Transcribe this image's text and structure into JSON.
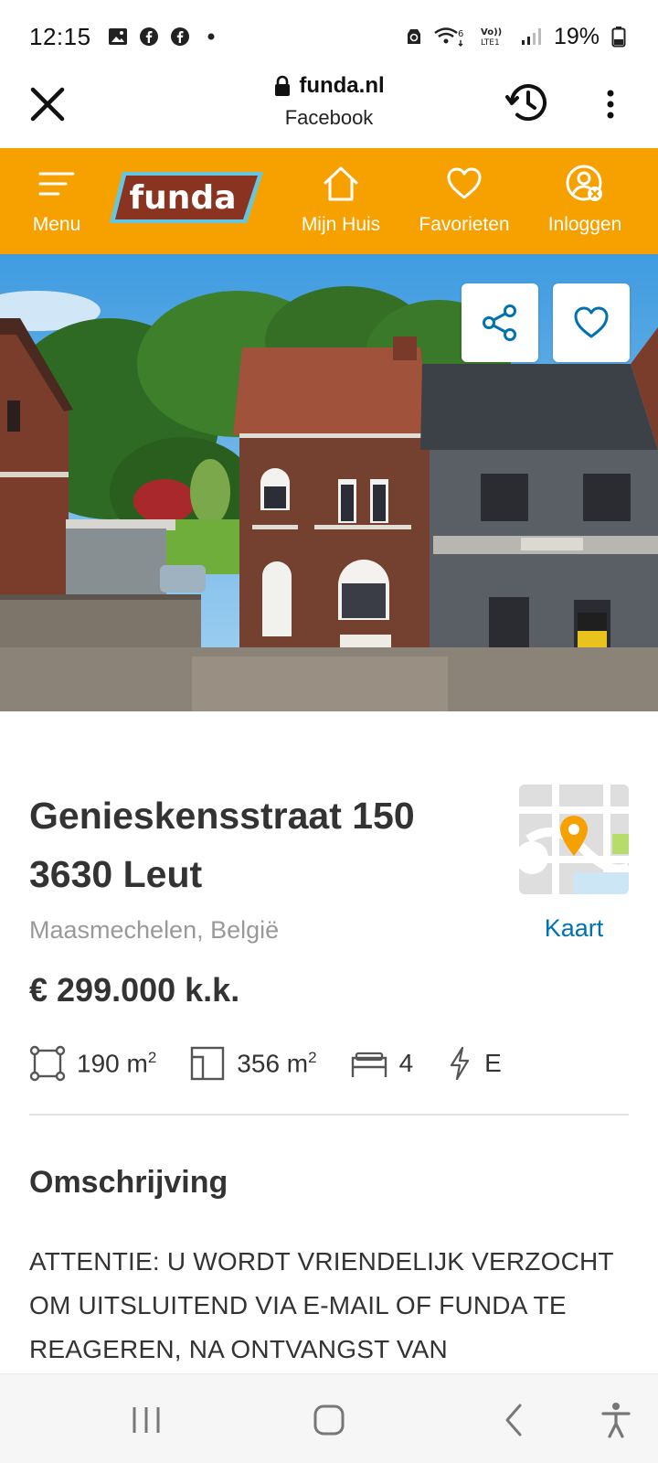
{
  "status_bar": {
    "time": "12:15",
    "left_icons": [
      "image-icon",
      "facebook-icon",
      "facebook-icon",
      "dot-icon"
    ],
    "right_icons": [
      "recycle-icon",
      "wifi6-icon",
      "volte-icon",
      "signal-icon"
    ],
    "battery": "19%"
  },
  "browser": {
    "domain": "funda.nl",
    "source": "Facebook",
    "close_icon": "close-icon",
    "history_icon": "history-icon",
    "more_icon": "more-vertical-icon"
  },
  "nav": {
    "menu": "Menu",
    "logo": "funda",
    "my_house": "Mijn Huis",
    "favorites": "Favorieten",
    "login": "Inloggen",
    "accent": "#f7a100"
  },
  "listing": {
    "address_line1": "Genieskensstraat 150",
    "address_line2": "3630 Leut",
    "city": "Maasmechelen, België",
    "map_label": "Kaart",
    "price": "€ 299.000 k.k.",
    "living_area": "190 m",
    "plot_area": "356 m",
    "area_exp": "2",
    "rooms": "4",
    "energy": "E",
    "section_title": "Omschrijving",
    "description": "ATTENTIE: U WORDT VRIENDELIJK VERZOCHT OM UITSLUITEND VIA E-MAIL OF FUNDA TE REAGEREN, NA ONTVANGST VAN"
  },
  "colors": {
    "link": "#0071b3",
    "price_text": "#333333",
    "muted": "#999999"
  }
}
